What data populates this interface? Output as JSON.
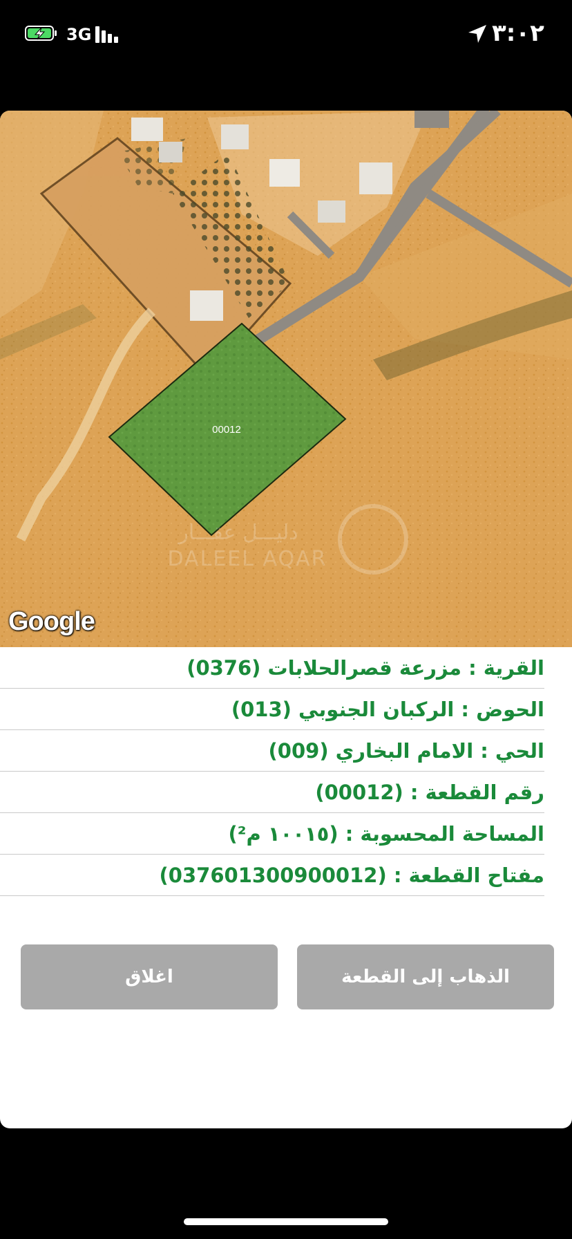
{
  "status_bar": {
    "network": "3G",
    "time": "٣:٠٢"
  },
  "map": {
    "parcel_label": "00012",
    "attribution": "Google",
    "watermark_ar": "دليـــل عقـــار",
    "watermark_en": "DALEEL AQAR",
    "parcel_color": "#5f9a3f"
  },
  "info": [
    "القرية : مزرعة قصرالحلابات (0376)",
    "الحوض : الركبان الجنوبي (013)",
    "الحي : الامام البخاري (009)",
    "رقم القطعة : (00012)",
    "المساحة المحسوبة : (١٠٠١٥ م²)",
    "مفتاح القطعة : (037601300900012)"
  ],
  "buttons": {
    "go_to_parcel": "الذهاب إلى القطعة",
    "close": "اغلاق"
  },
  "colors": {
    "text_accent": "#1a8a3a",
    "button_bg": "#a9a9a9"
  }
}
